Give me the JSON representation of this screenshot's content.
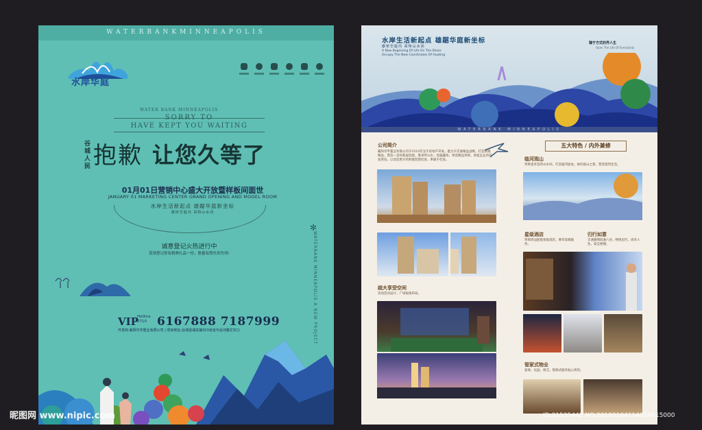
{
  "left_poster": {
    "top_band_text": "WATERBANKMINNEAPOLIS",
    "logo_text": "水岸华庭",
    "brand_tagline_small": "WATER BANK MINNEAPOLIS",
    "sorry_line1": "SORRY TO",
    "sorry_line2": "HAVE KEPT YOU WAITING",
    "vertical_label": "谷城人民",
    "headline_part1": "抱歉",
    "headline_part2": "让您久等了",
    "date_cn": "01月01日营销中心盛大开放暨样板间面世",
    "date_en": "JANUARY 01 MARKETING CENTER GRAND OPENING AND MODEL ROOM",
    "slogan": "水岸生活新起点  雄踞华庭新坐标",
    "slogan_sub": "康桥华庭内      哥特山水间",
    "registration": "诚意登记火热进行中",
    "registration_sub": "现场登记即有精美礼品一份，数量有限先到先得!",
    "vertical_en": "WATERBANK MINNEAPOLIS A NEW PROJECT",
    "vip_label": "VIP",
    "hotline_label": "Hotline 0710",
    "phone_numbers": "6167888 7187999",
    "address_line": "开发商:襄阳华宇置业有限公司 | 项目地址:谷城县城关镇303省道与谷河路交叉口",
    "colors": {
      "background": "#5fbfb4",
      "headline": "#173434",
      "phone": "#1a2d50"
    }
  },
  "right_poster": {
    "hero_title": "水岸生活新起点  雄踞华庭新坐标",
    "hero_sub": "康桥华庭内  哥特山水间",
    "hero_en1": "A New Beginning Of Life On The Shore",
    "hero_en2": "Occupy The New Coordinates Of Huating",
    "hero_right_title": "臻于方式的界人生",
    "hero_right_sub": "Open The Life Of Everybody",
    "hero_band_text": "WATERBANK MINNEAPOLIS",
    "section_company": {
      "title": "公司简介",
      "body": "襄阳华宇置业有限公司于2016年注于房地产开发，着力于实施精品战略，打造高端精品，营造一流的家居氛围，秉承传山水，现临襄阳，缔造精品项目，承担企业的社会责任。以创造更大的财富回馈社会，奉献于社会。"
    },
    "five_features_title": "五大特色 / 内外兼修",
    "section_river": {
      "title": "临河观山",
      "body": "项目坐享首府山水间，打造临河居住，依托观山之景，营造悠然生活。"
    },
    "section_hotel": {
      "title": "星级酒店",
      "body": "项目周边配套星级酒店，尊享高端服务。"
    },
    "section_travel": {
      "title": "归行如意",
      "body": "交通路网四通八达，畅快出行，尚享人生，安全便捷。"
    },
    "section_space": {
      "title": "超大享受空间",
      "body": "流动空间设计，广域视角布局。"
    },
    "section_property": {
      "title": "管家式物业",
      "body": "安保、化园、保洁，管家式服务贴心周到。"
    }
  },
  "watermark": {
    "site": "昵图网 www.nipic.com",
    "image_id": "ID:21535442 NO:20190104114054615000"
  }
}
